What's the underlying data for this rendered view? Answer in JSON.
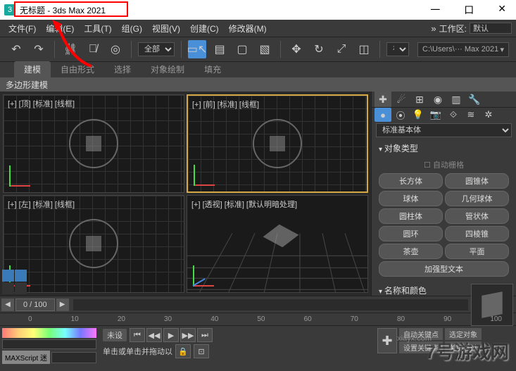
{
  "titlebar": {
    "app_icon_text": "3",
    "title": "无标题 - 3ds Max 2021",
    "min": "一",
    "max": "口",
    "close": "✕"
  },
  "menubar": {
    "items": [
      "文件(F)",
      "编辑(E)",
      "工具(T)",
      "组(G)",
      "视图(V)",
      "创建(C)",
      "修改器(M)"
    ],
    "doublearrow": "»",
    "workspace_label": "工作区:",
    "workspace_value": "默认"
  },
  "toolbar": {
    "filter_label": "全部",
    "path_value": "C:\\Users\\··· Max 2021",
    "view_label": "视"
  },
  "ribbon": {
    "tabs": [
      "建模",
      "自由形式",
      "选择",
      "对象绘制",
      "填充"
    ],
    "subtab": "多边形建模"
  },
  "viewports": {
    "top": "[+] [顶] [标准] [线框]",
    "front": "[+] [前] [标准] [线框]",
    "left": "[+] [左] [标准] [线框]",
    "persp": "[+] [透视] [标准] [默认明暗处理]"
  },
  "cmdpanel": {
    "dropdown": "标准基本体",
    "rollout1": "对象类型",
    "autogrid": "自动栅格",
    "buttons": [
      "长方体",
      "圆锥体",
      "球体",
      "几何球体",
      "圆柱体",
      "管状体",
      "圆环",
      "四棱锥",
      "茶壶",
      "平面"
    ],
    "extrude_btn": "加强型文本",
    "rollout2": "名称和颜色"
  },
  "timeslider": {
    "frame": "0 / 100"
  },
  "trackbar": {
    "ticks": [
      "0",
      "10",
      "20",
      "30",
      "40",
      "50",
      "60",
      "70",
      "80",
      "90",
      "100"
    ]
  },
  "bottom": {
    "maxscript_label": "MAXScript 迷",
    "undo": "未设",
    "prompt": "单击或单击并拖动以",
    "autokey": "自动关键点",
    "selkey": "选定对象",
    "setkey": "设置关键点",
    "keyfilter": "关键点过"
  },
  "watermark": "7号游戏网",
  "watermark2": "xiayx.com"
}
